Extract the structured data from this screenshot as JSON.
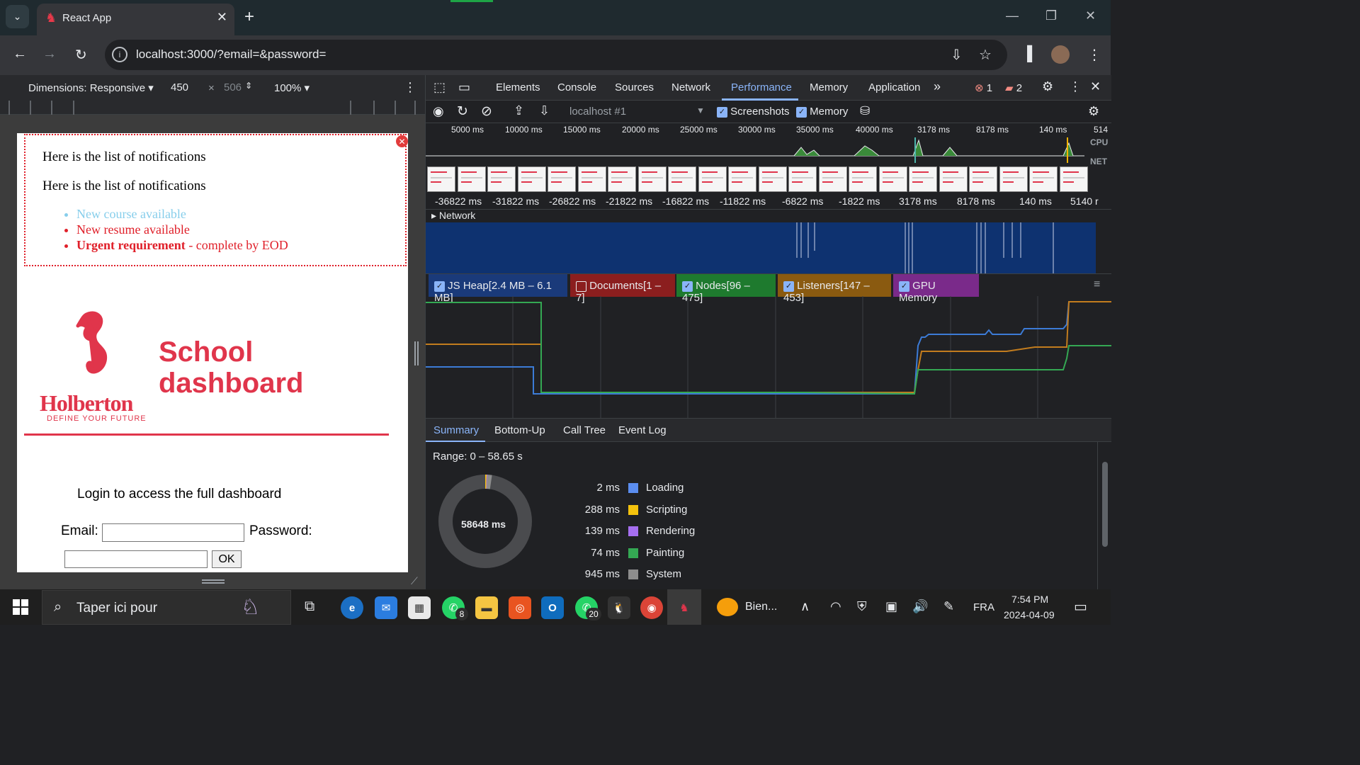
{
  "browser": {
    "tab_title": "React App",
    "url": "localhost:3000/?email=&password="
  },
  "device_toolbar": {
    "dimensions_label": "Dimensions: Responsive",
    "width": "450",
    "times": "×",
    "height": "506",
    "zoom": "100%"
  },
  "app": {
    "notifications_title_1": "Here is the list of notifications",
    "notifications_title_2": "Here is the list of notifications",
    "items": [
      {
        "text": "New course available",
        "color": "#87ceeb"
      },
      {
        "text": "New resume available",
        "color": "#e0202a"
      },
      {
        "bold": "Urgent requirement",
        "rest": " - complete by EOD",
        "color": "#e0202a"
      }
    ],
    "close_glyph": "✕",
    "logo_word": "Holberton",
    "logo_tagline": "DEFINE YOUR FUTURE",
    "title_line1": "School",
    "title_line2": "dashboard",
    "login_text": "Login to access the full dashboard",
    "email_label": "Email:",
    "password_label": "Password:",
    "ok_label": "OK",
    "brand_color": "#e0354b"
  },
  "devtools": {
    "tabs": [
      "Elements",
      "Console",
      "Sources",
      "Network",
      "Performance",
      "Memory",
      "Application"
    ],
    "more_tabs": "»",
    "errors": "1",
    "warnings": "2",
    "profile_select": "localhost #1",
    "screenshots_label": "Screenshots",
    "memory_label": "Memory",
    "overview_ticks": [
      "5000 ms",
      "10000 ms",
      "15000 ms",
      "20000 ms",
      "25000 ms",
      "30000 ms",
      "35000 ms",
      "40000 ms",
      "3178 ms",
      "8178 ms",
      "140 ms",
      "514"
    ],
    "cpu_label": "CPU",
    "net_label": "NET",
    "time_ticks": [
      "-36822 ms",
      "-31822 ms",
      "-26822 ms",
      "-21822 ms",
      "-16822 ms",
      "-11822 ms",
      "-6822 ms",
      "-1822 ms",
      "3178 ms",
      "8178 ms",
      "140 ms",
      "5140 r"
    ],
    "network_track": "Network",
    "counters": [
      {
        "label": "JS Heap[2.4 MB – 6.1 MB]",
        "checked": true,
        "color": "#1a3a7a"
      },
      {
        "label": "Documents[1 – 7]",
        "checked": false,
        "color": "#8b1e1e"
      },
      {
        "label": "Nodes[96 – 475]",
        "checked": true,
        "color": "#1e7a2e"
      },
      {
        "label": "Listeners[147 – 453]",
        "checked": true,
        "color": "#8a5a10"
      },
      {
        "label": "GPU Memory",
        "checked": true,
        "color": "#7a2a8a"
      }
    ],
    "bottom_tabs": [
      "Summary",
      "Bottom-Up",
      "Call Tree",
      "Event Log"
    ],
    "range": "Range: 0 – 58.65 s",
    "total": "58648 ms",
    "summary_rows": [
      {
        "value": "2 ms",
        "label": "Loading",
        "color": "#5b8def"
      },
      {
        "value": "288 ms",
        "label": "Scripting",
        "color": "#f4c20d"
      },
      {
        "value": "139 ms",
        "label": "Rendering",
        "color": "#a66ff0"
      },
      {
        "value": "74 ms",
        "label": "Painting",
        "color": "#34a853"
      },
      {
        "value": "945 ms",
        "label": "System",
        "color": "#8d8d8d"
      }
    ]
  },
  "taskbar": {
    "search_placeholder": "Taper ici pour",
    "whatsapp_badge": "8",
    "whatsapp2_badge": "20",
    "weather": "Bien...",
    "lang": "FRA",
    "time": "7:54 PM",
    "date": "2024-04-09"
  }
}
